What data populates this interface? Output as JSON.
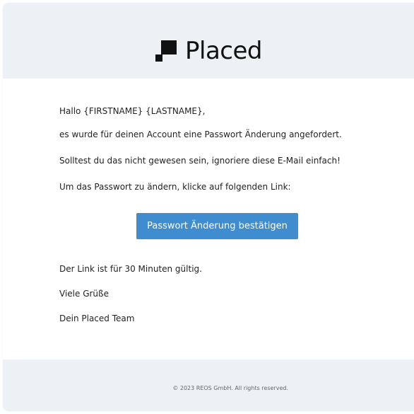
{
  "brand": {
    "name": "Placed",
    "logo_icon": "placed-logo-icon"
  },
  "email": {
    "greeting": "Hallo {FIRSTNAME} {LASTNAME},",
    "line1": "es wurde für deinen Account eine Passwort Änderung angefordert.",
    "line2": "Solltest du das nicht gewesen sein, ignoriere diese E-Mail einfach!",
    "line3": "Um das Passwort zu ändern, klicke auf folgenden Link:",
    "cta_label": "Passwort Änderung bestätigen",
    "validity": "Der Link ist für 30 Minuten gültig.",
    "closing": "Viele Grüße",
    "signature": "Dein Placed Team"
  },
  "footer": {
    "copyright": "© 2023 REOS GmbH. All rights reserved."
  },
  "colors": {
    "header_bg": "#edf1f5",
    "button_bg": "#3f8cce",
    "text": "#222222"
  }
}
